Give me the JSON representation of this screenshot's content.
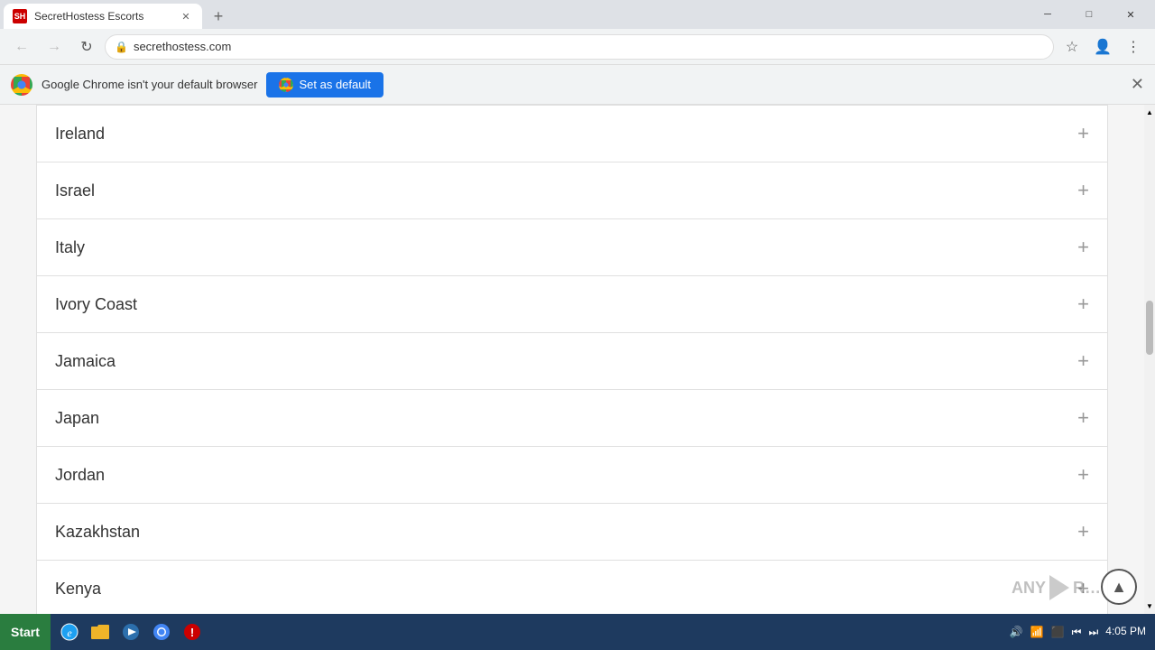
{
  "browser": {
    "tab_favicon": "SH",
    "tab_title": "SecretHostess Escorts",
    "address": "secrethostess.com",
    "new_tab_label": "+",
    "nav": {
      "back": "←",
      "forward": "→",
      "refresh": "↻"
    },
    "window_controls": {
      "minimize": "─",
      "maximize": "□",
      "close": "✕"
    }
  },
  "notification": {
    "message": "Google Chrome isn't your default browser",
    "set_default": "Set as default",
    "close": "✕"
  },
  "countries": [
    {
      "name": "Ireland"
    },
    {
      "name": "Israel"
    },
    {
      "name": "Italy"
    },
    {
      "name": "Ivory Coast"
    },
    {
      "name": "Jamaica"
    },
    {
      "name": "Japan"
    },
    {
      "name": "Jordan"
    },
    {
      "name": "Kazakhstan"
    },
    {
      "name": "Kenya"
    }
  ],
  "taskbar": {
    "start_label": "Start",
    "time": "4:05 PM"
  },
  "plus_symbol": "+",
  "up_arrow": "▲",
  "watermark_text": "ANY"
}
